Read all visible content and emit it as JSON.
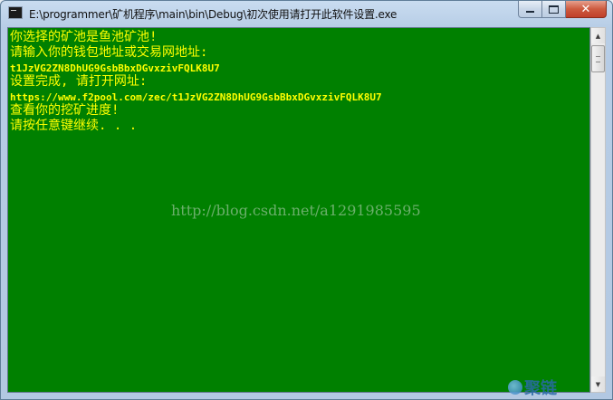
{
  "window": {
    "title": "E:\\programmer\\矿机程序\\main\\bin\\Debug\\初次使用请打开此软件设置.exe",
    "close_glyph": "✕"
  },
  "console": {
    "lines": [
      "你选择的矿池是鱼池矿池!",
      "请输入你的钱包地址或交易网地址:",
      "t1JzVG2ZN8DhUG9GsbBbxDGvxzivFQLK8U7",
      "设置完成, 请打开网址:",
      "https://www.f2pool.com/zec/t1JzVG2ZN8DhUG9GsbBbxDGvxzivFQLK8U7",
      "查看你的挖矿进度!",
      "请按任意键继续. . ."
    ],
    "text_color": "#ffff00",
    "background_color": "#008000"
  },
  "watermark": "http://blog.csdn.net/a1291985595",
  "corner_logo": "聚链"
}
